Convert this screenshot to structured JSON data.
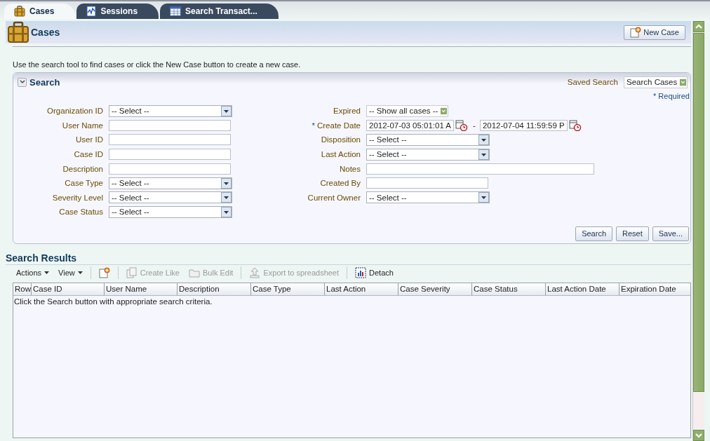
{
  "tabs": [
    {
      "label": "Cases",
      "selected": true
    },
    {
      "label": "Sessions",
      "selected": false
    },
    {
      "label": "Search Transact...",
      "selected": false
    }
  ],
  "header": {
    "title": "Cases",
    "new_button": "New Case"
  },
  "instructions": "Use the search tool to find cases or click the New Case button to create a new case.",
  "search_panel": {
    "title": "Search",
    "expanded": true,
    "saved_search_label": "Saved Search",
    "saved_search_value": "Search Cases",
    "required_note": "* Required",
    "left_fields": [
      {
        "label": "Organization ID",
        "kind": "select",
        "value": "-- Select --"
      },
      {
        "label": "User Name",
        "kind": "text"
      },
      {
        "label": "User ID",
        "kind": "text"
      },
      {
        "label": "Case ID",
        "kind": "text"
      },
      {
        "label": "Description",
        "kind": "text"
      },
      {
        "label": "Case Type",
        "kind": "select",
        "value": "-- Select --"
      },
      {
        "label": "Severity Level",
        "kind": "select",
        "value": "-- Select --"
      },
      {
        "label": "Case Status",
        "kind": "select",
        "value": "-- Select --"
      }
    ],
    "right_fields": [
      {
        "label": "Expired",
        "kind": "combo",
        "value": "-- Show all cases --"
      },
      {
        "label": "Create Date",
        "kind": "daterange",
        "required_mark": "*",
        "from": "2012-07-03 05:01:01 A",
        "separator": "-",
        "to": "2012-07-04 11:59:59 P"
      },
      {
        "label": "Disposition",
        "kind": "select",
        "value": "-- Select --"
      },
      {
        "label": "Last Action",
        "kind": "select",
        "value": "-- Select --"
      },
      {
        "label": "Notes",
        "kind": "wide"
      },
      {
        "label": "Created By",
        "kind": "text"
      },
      {
        "label": "Current Owner",
        "kind": "select",
        "value": "-- Select --"
      }
    ],
    "buttons": [
      "Search",
      "Reset",
      "Save..."
    ]
  },
  "results": {
    "title": "Search Results",
    "toolbar": [
      {
        "kind": "menu",
        "label": "Actions",
        "disabled": false
      },
      {
        "kind": "menu",
        "label": "View",
        "disabled": false
      },
      {
        "kind": "separator"
      },
      {
        "kind": "new",
        "disabled": false
      },
      {
        "kind": "separator"
      },
      {
        "kind": "create-like",
        "label": "Create Like",
        "disabled": true
      },
      {
        "kind": "bulk-edit",
        "label": "Bulk Edit",
        "disabled": true
      },
      {
        "kind": "separator"
      },
      {
        "kind": "export",
        "label": "Export to spreadsheet",
        "disabled": true
      },
      {
        "kind": "separator"
      },
      {
        "kind": "detach",
        "label": "Detach",
        "disabled": false
      }
    ],
    "columns": [
      "Row",
      "Case ID",
      "User Name",
      "Description",
      "Case Type",
      "Last Action",
      "Case Severity",
      "Case Status",
      "Last Action Date",
      "Expiration Date"
    ],
    "empty_message": "Click the Search button with appropriate search criteria."
  }
}
